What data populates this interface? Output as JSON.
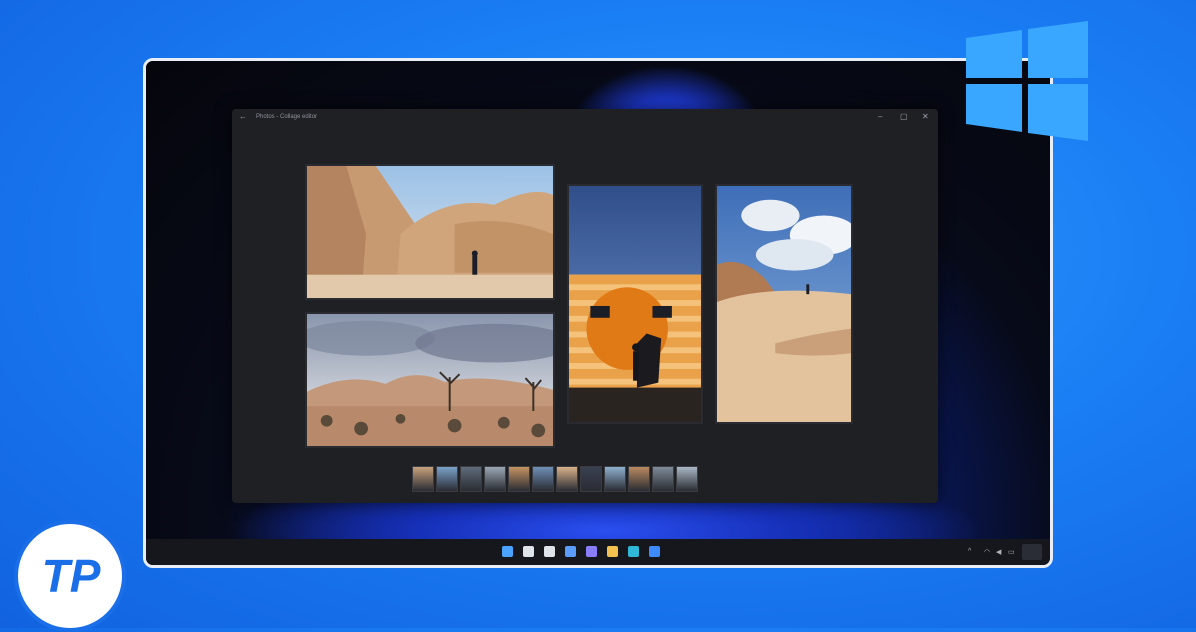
{
  "app": {
    "back_glyph": "←",
    "title": "Photos - Collage editor",
    "controls": {
      "minimize": "–",
      "maximize": "▢",
      "close": "✕"
    }
  },
  "collage": {
    "tiles": [
      {
        "name": "desert-rocks-hiker",
        "subject": "rocks and hiker"
      },
      {
        "name": "joshua-tree-desert",
        "subject": "joshua trees"
      },
      {
        "name": "orange-striped-wall",
        "subject": "striped wall"
      },
      {
        "name": "desert-rock-cloudy-sky",
        "subject": "rock under sky"
      }
    ]
  },
  "filmstrip": {
    "thumb_count": 12,
    "colors": [
      "#c7a27b",
      "#7aa2c9",
      "#5e6b7a",
      "#9aa7b3",
      "#c49363",
      "#6f8fb5",
      "#d8b18a",
      "#3a4050",
      "#8fb0d0",
      "#b98a60",
      "#7f8b99",
      "#a9b7c4"
    ]
  },
  "taskbar": {
    "icons": [
      {
        "name": "start-icon",
        "color": "#4aa3ff"
      },
      {
        "name": "search-icon",
        "color": "#dfe3ea"
      },
      {
        "name": "task-view-icon",
        "color": "#dfe3ea"
      },
      {
        "name": "widgets-icon",
        "color": "#5b9cff"
      },
      {
        "name": "chat-icon",
        "color": "#8a7dff"
      },
      {
        "name": "file-explorer-icon",
        "color": "#f2c14e"
      },
      {
        "name": "edge-icon",
        "color": "#2fb8d8"
      },
      {
        "name": "store-icon",
        "color": "#3d8bff"
      }
    ],
    "tray": {
      "chevron": "^",
      "wifi": "◠",
      "speaker": "◀",
      "battery": "▭"
    },
    "clock": {
      "time": "",
      "date": ""
    }
  },
  "branding": {
    "windows_logo_color": "#39a7ff",
    "tp_text": "TP",
    "tp_color": "#1a6fe8"
  }
}
